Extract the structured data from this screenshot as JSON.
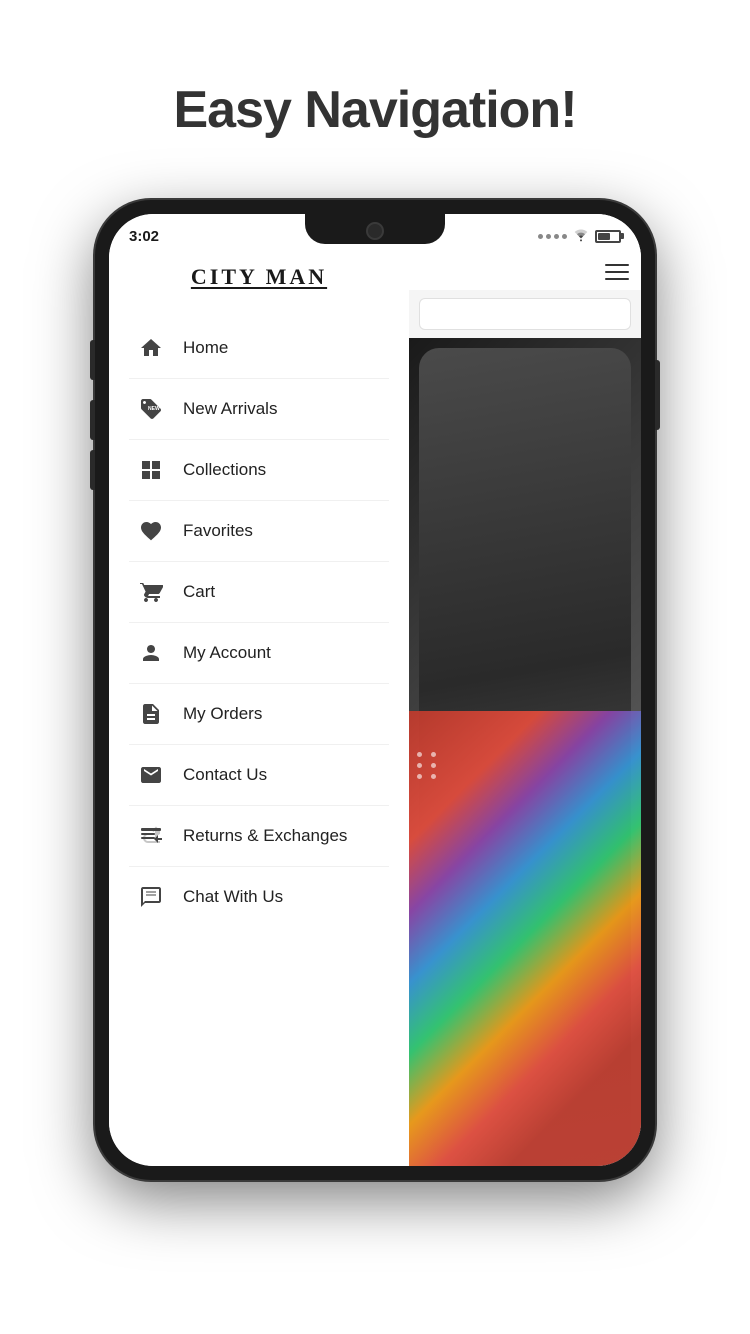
{
  "page": {
    "title": "Easy Navigation!",
    "subtitle": "Easy Navigation!"
  },
  "status_bar": {
    "time": "3:02"
  },
  "drawer": {
    "logo": "CITY MAN",
    "menu_items": [
      {
        "id": "home",
        "label": "Home",
        "icon": "home"
      },
      {
        "id": "new-arrivals",
        "label": "New Arrivals",
        "icon": "new-tag"
      },
      {
        "id": "collections",
        "label": "Collections",
        "icon": "grid"
      },
      {
        "id": "favorites",
        "label": "Favorites",
        "icon": "heart"
      },
      {
        "id": "cart",
        "label": "Cart",
        "icon": "cart"
      },
      {
        "id": "my-account",
        "label": "My Account",
        "icon": "account"
      },
      {
        "id": "my-orders",
        "label": "My Orders",
        "icon": "orders"
      },
      {
        "id": "contact-us",
        "label": "Contact Us",
        "icon": "contact"
      },
      {
        "id": "returns",
        "label": "Returns & Exchanges",
        "icon": "returns"
      },
      {
        "id": "chat",
        "label": "Chat With Us",
        "icon": "chat"
      }
    ]
  }
}
